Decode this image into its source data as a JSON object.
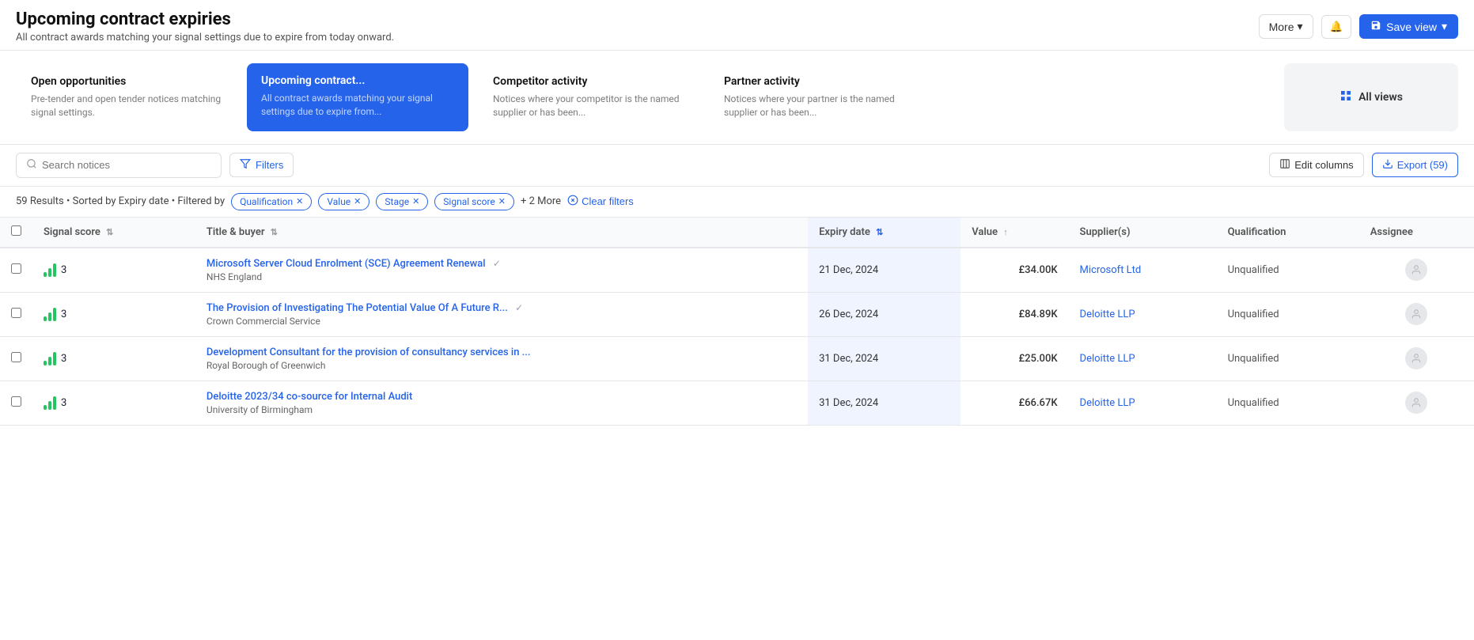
{
  "header": {
    "title": "Upcoming contract expiries",
    "subtitle": "All contract awards matching your signal settings due to expire from today onward.",
    "more_label": "More",
    "save_view_label": "Save view"
  },
  "nav_cards": [
    {
      "id": "open-opportunities",
      "title": "Open opportunities",
      "description": "Pre-tender and open tender notices matching signal settings.",
      "active": false
    },
    {
      "id": "upcoming-contract",
      "title": "Upcoming contract...",
      "description": "All contract awards matching your signal settings due to expire from...",
      "active": true
    },
    {
      "id": "competitor-activity",
      "title": "Competitor activity",
      "description": "Notices where your competitor is the named supplier or has been...",
      "active": false
    },
    {
      "id": "partner-activity",
      "title": "Partner activity",
      "description": "Notices where your partner is the named supplier or has been...",
      "active": false
    }
  ],
  "all_views_label": "All views",
  "toolbar": {
    "search_placeholder": "Search notices",
    "filters_label": "Filters",
    "edit_columns_label": "Edit columns",
    "export_label": "Export (59)"
  },
  "filter_bar": {
    "results_text": "59 Results",
    "sort_text": "Sorted by Expiry date",
    "filter_text": "Filtered by",
    "chips": [
      {
        "label": "Qualification"
      },
      {
        "label": "Value"
      },
      {
        "label": "Stage"
      },
      {
        "label": "Signal score"
      }
    ],
    "more_label": "+ 2 More",
    "clear_label": "Clear filters"
  },
  "table": {
    "columns": [
      {
        "id": "signal_score",
        "label": "Signal score",
        "sortable": true
      },
      {
        "id": "title_buyer",
        "label": "Title & buyer",
        "sortable": true
      },
      {
        "id": "expiry_date",
        "label": "Expiry date",
        "sortable": true,
        "active": true
      },
      {
        "id": "value",
        "label": "Value",
        "sortable": true
      },
      {
        "id": "suppliers",
        "label": "Supplier(s)",
        "sortable": false
      },
      {
        "id": "qualification",
        "label": "Qualification",
        "sortable": false
      },
      {
        "id": "assignee",
        "label": "Assignee",
        "sortable": false
      }
    ],
    "rows": [
      {
        "signal_score": 3,
        "title": "Microsoft Server Cloud Enrolment (SCE) Agreement Renewal",
        "buyer": "NHS England",
        "expiry_date": "21 Dec, 2024",
        "value": "£34.00K",
        "supplier": "Microsoft Ltd",
        "qualification": "Unqualified",
        "has_check": true
      },
      {
        "signal_score": 3,
        "title": "The Provision of Investigating The Potential Value Of A Future R...",
        "buyer": "Crown Commercial Service",
        "expiry_date": "26 Dec, 2024",
        "value": "£84.89K",
        "supplier": "Deloitte LLP",
        "qualification": "Unqualified",
        "has_check": true
      },
      {
        "signal_score": 3,
        "title": "Development Consultant for the provision of consultancy services in ...",
        "buyer": "Royal Borough of Greenwich",
        "expiry_date": "31 Dec, 2024",
        "value": "£25.00K",
        "supplier": "Deloitte LLP",
        "qualification": "Unqualified",
        "has_check": false
      },
      {
        "signal_score": 3,
        "title": "Deloitte 2023/34 co-source for Internal Audit",
        "buyer": "University of Birmingham",
        "expiry_date": "31 Dec, 2024",
        "value": "£66.67K",
        "supplier": "Deloitte LLP",
        "qualification": "Unqualified",
        "has_check": false
      }
    ]
  },
  "colors": {
    "primary": "#2563eb",
    "active_nav": "#2563eb",
    "signal_bar": "#22c55e"
  }
}
